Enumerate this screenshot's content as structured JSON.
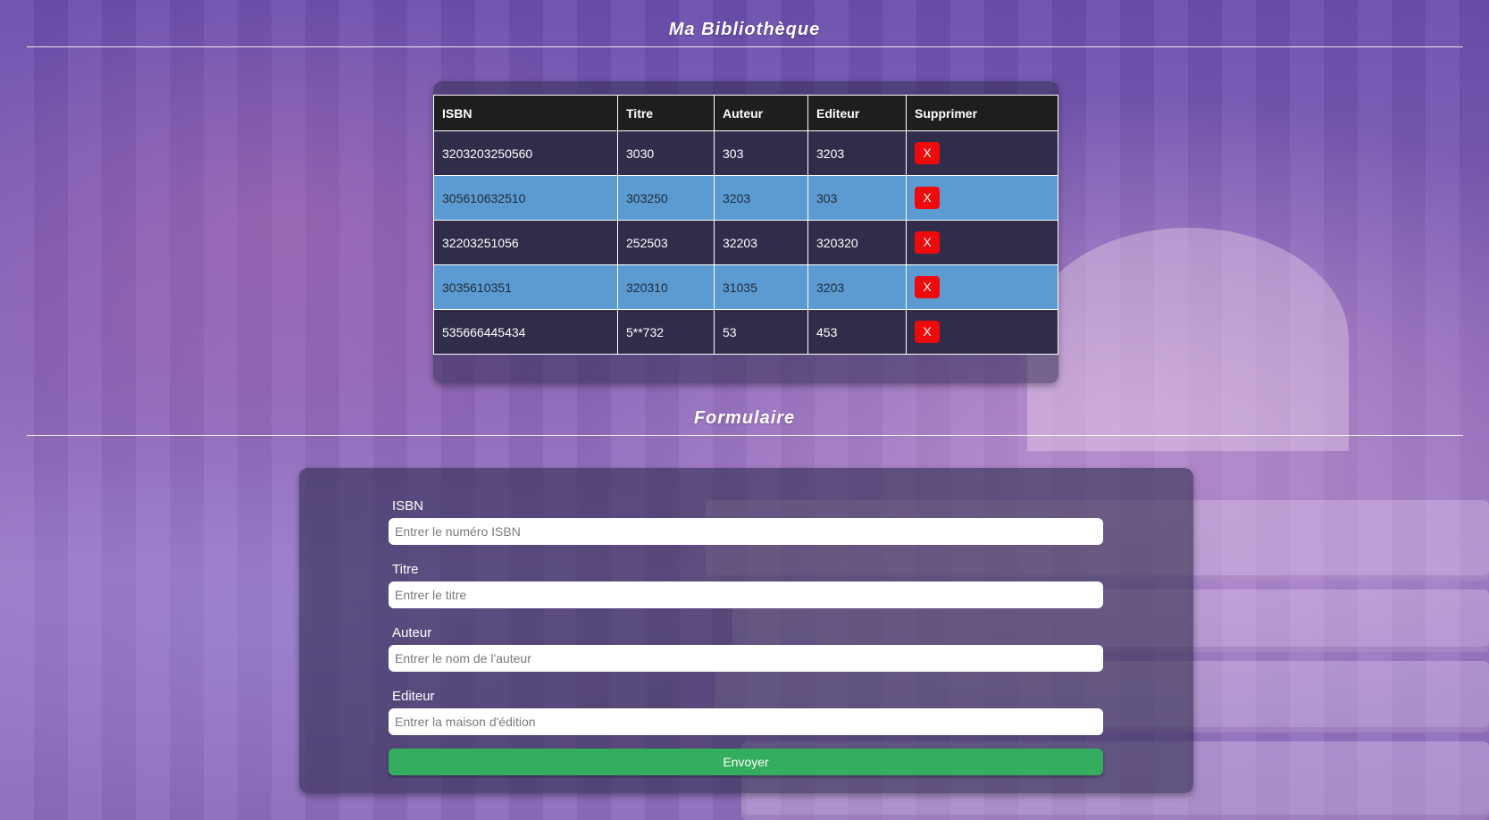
{
  "header": {
    "title": "Ma Bibliothèque"
  },
  "table": {
    "columns": [
      "ISBN",
      "Titre",
      "Auteur",
      "Editeur",
      "Supprimer"
    ],
    "rows": [
      {
        "isbn": "3203203250560",
        "titre": "3030",
        "auteur": "303",
        "editeur": "3203",
        "delete_label": "X"
      },
      {
        "isbn": "305610632510",
        "titre": "303250",
        "auteur": "3203",
        "editeur": "303",
        "delete_label": "X"
      },
      {
        "isbn": "32203251056",
        "titre": "252503",
        "auteur": "32203",
        "editeur": "320320",
        "delete_label": "X"
      },
      {
        "isbn": "3035610351",
        "titre": "320310",
        "auteur": "31035",
        "editeur": "3203",
        "delete_label": "X"
      },
      {
        "isbn": "535666445434",
        "titre": "5**732",
        "auteur": "53",
        "editeur": "453",
        "delete_label": "X"
      }
    ]
  },
  "form": {
    "title": "Formulaire",
    "isbn": {
      "label": "ISBN",
      "placeholder": "Entrer le numéro ISBN",
      "value": ""
    },
    "titre": {
      "label": "Titre",
      "placeholder": "Entrer le titre",
      "value": ""
    },
    "auteur": {
      "label": "Auteur",
      "placeholder": "Entrer le nom de l'auteur",
      "value": ""
    },
    "editeur": {
      "label": "Editeur",
      "placeholder": "Entrer la maison d'édition",
      "value": ""
    },
    "submit_label": "Envoyer"
  },
  "colors": {
    "header_row": "#1e1e1e",
    "dark_row": "#2f2d4a",
    "light_row": "#5b9bd1",
    "delete_button": "#ee0a0a",
    "submit_button": "#34ad5e"
  }
}
